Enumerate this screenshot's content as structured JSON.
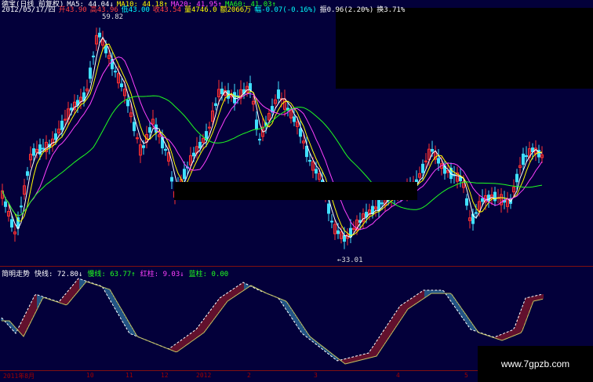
{
  "header": {
    "row1": [
      {
        "text": "德宝(日线 前复权)",
        "color": "#ffffff"
      },
      {
        "text": "MA5: 44.04↓",
        "color": "#ffffff"
      },
      {
        "text": "MA10: 44.18↑",
        "color": "#ffff00"
      },
      {
        "text": "MA20: 41.95↑",
        "color": "#ff40ff"
      },
      {
        "text": "MA60: 41.03↑",
        "color": "#20ff20"
      }
    ],
    "row2": [
      {
        "text": "2012/05/17/四",
        "color": "#ffffff"
      },
      {
        "text": "开43.90",
        "color": "#ff4040"
      },
      {
        "text": "高43.96",
        "color": "#ff4040"
      },
      {
        "text": "低43.00",
        "color": "#00ffff"
      },
      {
        "text": "收43.54",
        "color": "#ff4040"
      },
      {
        "text": "量4746.0",
        "color": "#ffff00"
      },
      {
        "text": "额2066万",
        "color": "#ffff00"
      },
      {
        "text": "幅-0.07(-0.16%)",
        "color": "#00ffff"
      },
      {
        "text": "振0.96(2.20%)",
        "color": "#ffffff"
      },
      {
        "text": "换3.71%",
        "color": "#ffffff"
      }
    ]
  },
  "annotations": {
    "high": "59.82",
    "low": "←33.01"
  },
  "indicator": {
    "items": [
      {
        "text": "简明走势",
        "color": "#ffffff"
      },
      {
        "text": "快线: 72.80↓",
        "color": "#ffffff"
      },
      {
        "text": "慢线: 63.77↑",
        "color": "#20ff20"
      },
      {
        "text": "红柱: 9.03↓",
        "color": "#ff40ff"
      },
      {
        "text": "蓝柱: 0.00",
        "color": "#20ff20"
      }
    ]
  },
  "axis_ticks": [
    "2011年8月",
    "10",
    "11",
    "12",
    "2012",
    "2",
    "3",
    "4",
    "5"
  ],
  "watermark": "www.7gpzb.com",
  "colors": {
    "background": "#03003a",
    "up_candle": "#ff3030",
    "down_candle": "#40e0ff",
    "ma5": "#ffffff",
    "ma10": "#ffff00",
    "ma20": "#ff40ff",
    "ma60": "#20ff20"
  }
}
